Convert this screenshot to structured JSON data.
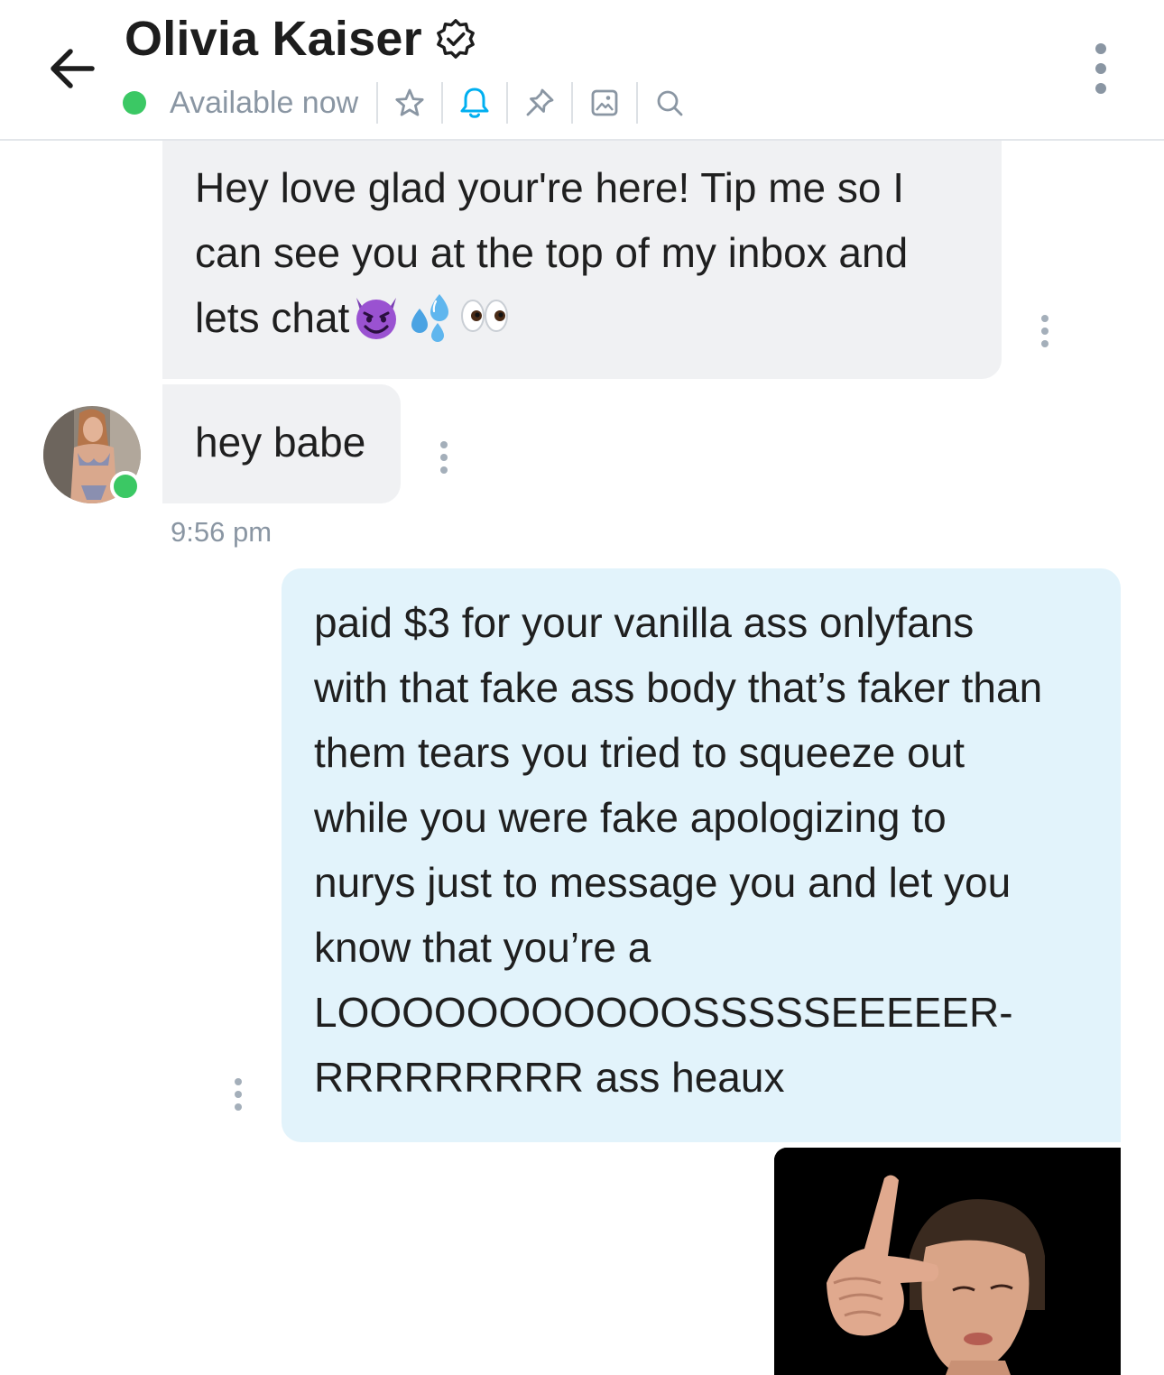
{
  "header": {
    "contact_name": "Olivia Kaiser",
    "status": "Available now",
    "icons": [
      "back-arrow-icon",
      "verified-icon",
      "star-icon",
      "bell-icon",
      "pin-icon",
      "image-icon",
      "search-icon",
      "more-vertical-icon"
    ]
  },
  "messages": [
    {
      "direction": "incoming",
      "lines": [
        "Hey love glad your're here! Tip me so I",
        "can see you at the top of my inbox and",
        "lets chat"
      ],
      "emoji": [
        "smiling-devil-emoji",
        "sweat-droplets-emoji",
        "eyes-emoji"
      ]
    },
    {
      "direction": "incoming",
      "text": "hey babe",
      "time": "9:56 pm"
    },
    {
      "direction": "outgoing",
      "lines": [
        "paid $3 for your vanilla ass onlyfans",
        "with that fake ass body that’s faker than",
        "them tears you tried to squeeze out",
        "while you were fake apologizing to",
        "nurys just to message you and let you",
        "know that you’re a",
        "LOOOOOOOOOOOSSSSSEEEEER-",
        "RRRRRRRRR ass heaux"
      ]
    },
    {
      "direction": "outgoing",
      "type": "gif"
    }
  ],
  "colors": {
    "online": "#3bc864",
    "accent": "#00aff0",
    "incoming_bubble": "#f0f1f3",
    "outgoing_bubble": "#e2f3fb",
    "muted_text": "#8a96a3"
  }
}
